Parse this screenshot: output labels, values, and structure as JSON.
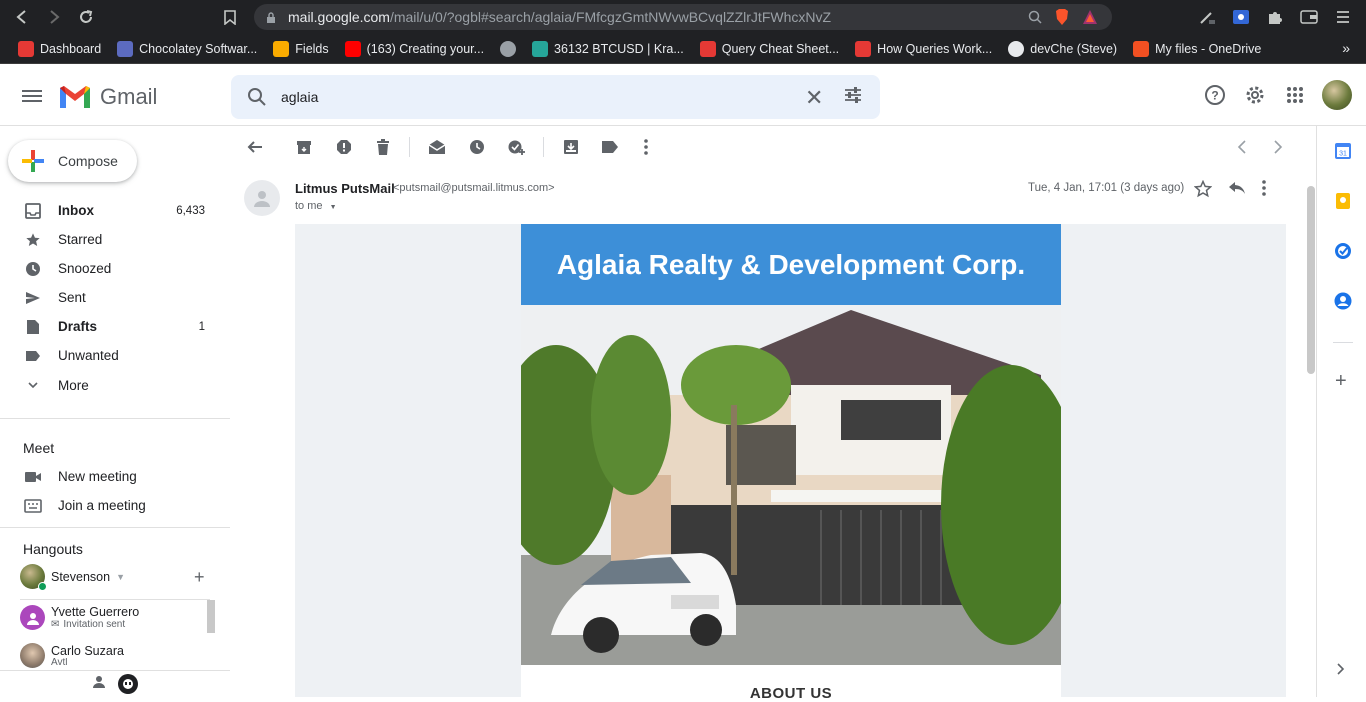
{
  "browser": {
    "url_host": "mail.google.com",
    "url_path": "/mail/u/0/?ogbl#search/aglaia/FMfcgzGmtNWvwBCvqlZZlrJtFWhcxNvZ",
    "bookmarks": [
      {
        "label": "Dashboard",
        "icon": "brand-red-icon",
        "color": "#e53935"
      },
      {
        "label": "Chocolatey Softwar...",
        "icon": "chocolatey-icon",
        "color": "#5c6bc0"
      },
      {
        "label": "Fields",
        "icon": "folder-icon",
        "color": "#f9ab00"
      },
      {
        "label": "(163) Creating your...",
        "icon": "youtube-icon",
        "color": "#ff0000"
      },
      {
        "label": "",
        "icon": "globe-icon",
        "color": "#9aa0a6"
      },
      {
        "label": "36132 BTCUSD | Kra...",
        "icon": "chart-icon",
        "color": "#26a69a"
      },
      {
        "label": "Query Cheat Sheet...",
        "icon": "s-icon",
        "color": "#e53935"
      },
      {
        "label": "How Queries Work...",
        "icon": "s-icon",
        "color": "#e53935"
      },
      {
        "label": "devChe (Steve)",
        "icon": "github-icon",
        "color": "#e8eaed"
      },
      {
        "label": "My files - OneDrive",
        "icon": "microsoft-icon",
        "color": "#f25022"
      }
    ]
  },
  "gmail": {
    "wordmark": "Gmail",
    "search_value": "aglaia"
  },
  "sidebar": {
    "compose": "Compose",
    "items": [
      {
        "label": "Inbox",
        "count": "6,433",
        "icon": "inbox-icon",
        "bold": true
      },
      {
        "label": "Starred",
        "count": "",
        "icon": "star-icon",
        "bold": false
      },
      {
        "label": "Snoozed",
        "count": "",
        "icon": "clock-icon",
        "bold": false
      },
      {
        "label": "Sent",
        "count": "",
        "icon": "send-icon",
        "bold": false
      },
      {
        "label": "Drafts",
        "count": "1",
        "icon": "draft-icon",
        "bold": true
      },
      {
        "label": "Unwanted",
        "count": "",
        "icon": "label-icon",
        "bold": false
      },
      {
        "label": "More",
        "count": "",
        "icon": "chevron-down-icon",
        "bold": false
      }
    ],
    "meet_title": "Meet",
    "new_meeting": "New meeting",
    "join_meeting": "Join a meeting",
    "hangouts_title": "Hangouts",
    "hangouts_user": "Stevenson",
    "contacts": [
      {
        "name": "Yvette Guerrero",
        "status": "Invitation sent"
      },
      {
        "name": "Carlo Suzara",
        "status": "Avtl"
      }
    ]
  },
  "message": {
    "sender_name": "Litmus PutsMail",
    "sender_email": "<putsmail@putsmail.litmus.com>",
    "to": "to me",
    "date": "Tue, 4 Jan, 17:01 (3 days ago)",
    "banner_title": "Aglaia Realty & Development Corp.",
    "section_heading": "ABOUT US",
    "banner_color": "#3d8fd8"
  }
}
